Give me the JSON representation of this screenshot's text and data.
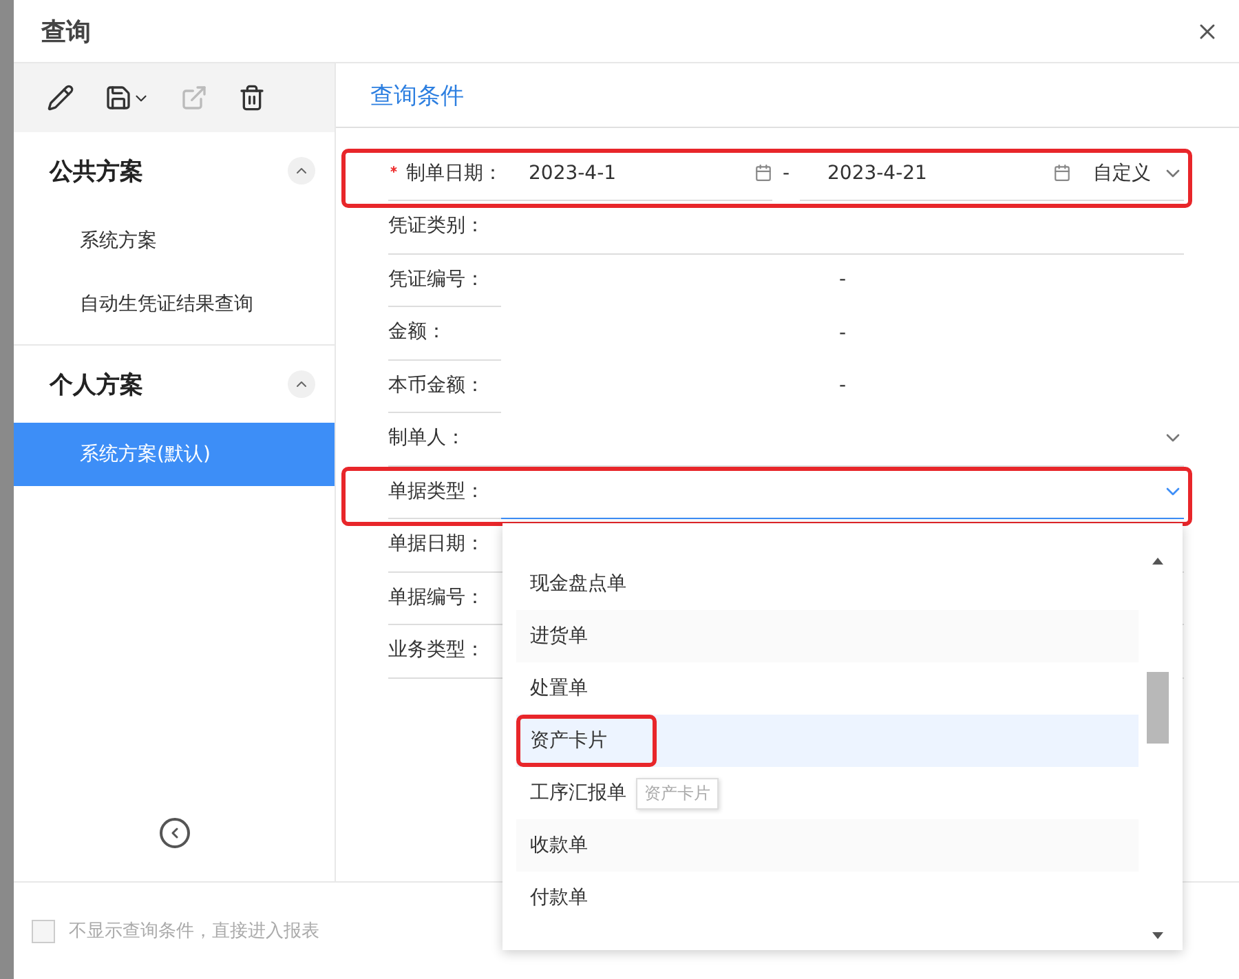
{
  "window": {
    "title": "查询"
  },
  "toolbar": [
    {
      "kind": "edit",
      "disabled": false
    },
    {
      "kind": "save",
      "disabled": false
    },
    {
      "kind": "export",
      "disabled": true
    },
    {
      "kind": "delete",
      "disabled": false
    }
  ],
  "sidebar": {
    "groups": [
      {
        "title": "公共方案",
        "expanded": true,
        "items": [
          {
            "label": "系统方案",
            "selected": false
          },
          {
            "label": "自动生凭证结果查询",
            "selected": false
          }
        ]
      },
      {
        "title": "个人方案",
        "expanded": true,
        "items": [
          {
            "label": "系统方案(默认)",
            "selected": true
          }
        ]
      }
    ]
  },
  "tabs": [
    {
      "label": "查询条件",
      "selected": true
    }
  ],
  "fields": [
    {
      "kind": "date_range",
      "label": "制单日期：",
      "required": true,
      "highlighted": true,
      "from": "2023-4-1",
      "separator": "-",
      "to": "2023-4-21",
      "preset": "自定义"
    },
    {
      "kind": "text",
      "label": "凭证类别：",
      "required": false,
      "highlighted": false
    },
    {
      "kind": "range",
      "label": "凭证编号：",
      "required": false,
      "highlighted": false,
      "separator": "-"
    },
    {
      "kind": "range",
      "label": "金额：",
      "required": false,
      "highlighted": false,
      "separator": "-"
    },
    {
      "kind": "range",
      "label": "本币金额：",
      "required": false,
      "highlighted": false,
      "separator": "-"
    },
    {
      "kind": "select",
      "label": "制单人：",
      "required": false,
      "highlighted": false,
      "expanded": false
    },
    {
      "kind": "select",
      "label": "单据类型：",
      "required": false,
      "highlighted": true,
      "expanded": true
    },
    {
      "kind": "text",
      "label": "单据日期：",
      "required": false,
      "highlighted": false
    },
    {
      "kind": "text",
      "label": "单据编号：",
      "required": false,
      "highlighted": false
    },
    {
      "kind": "text",
      "label": "业务类型：",
      "required": false,
      "highlighted": false
    }
  ],
  "dropdown": {
    "options": [
      {
        "label": "现金盘点单",
        "selected": false,
        "highlighted": false
      },
      {
        "label": "进货单",
        "selected": false,
        "highlighted": false
      },
      {
        "label": "处置单",
        "selected": false,
        "highlighted": false
      },
      {
        "label": "资产卡片",
        "selected": true,
        "highlighted": true
      },
      {
        "label": "工序汇报单",
        "selected": false,
        "highlighted": false
      },
      {
        "label": "收款单",
        "selected": false,
        "highlighted": false
      },
      {
        "label": "付款单",
        "selected": false,
        "highlighted": false
      }
    ],
    "tooltip": "资产卡片"
  },
  "footer": {
    "checkbox": {
      "label": "不显示查询条件，直接进入报表",
      "checked": false
    }
  }
}
